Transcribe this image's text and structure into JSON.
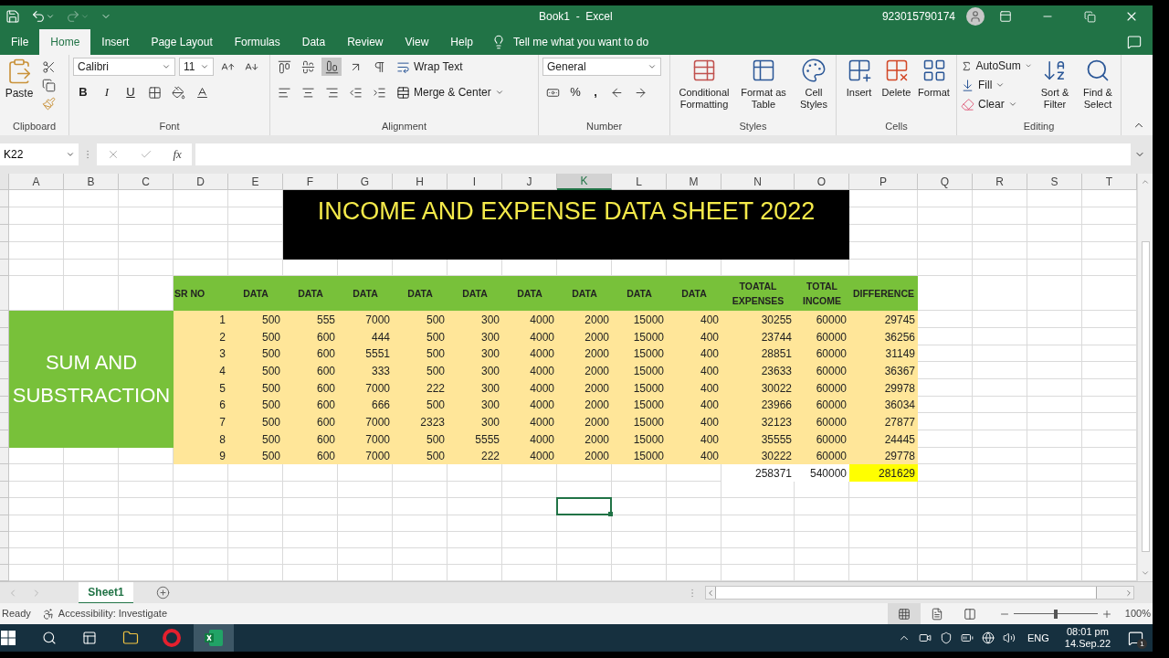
{
  "title_bar": {
    "title": "Book1  -  Excel",
    "account": "923015790174"
  },
  "ribbon_tabs": [
    {
      "label": "File",
      "selected": false
    },
    {
      "label": "Home",
      "selected": true
    },
    {
      "label": "Insert",
      "selected": false
    },
    {
      "label": "Page Layout",
      "selected": false
    },
    {
      "label": "Formulas",
      "selected": false
    },
    {
      "label": "Data",
      "selected": false
    },
    {
      "label": "Review",
      "selected": false
    },
    {
      "label": "View",
      "selected": false
    },
    {
      "label": "Help",
      "selected": false
    }
  ],
  "tell_me": "Tell me what you want to do",
  "ribbon": {
    "clipboard": {
      "paste": "Paste",
      "label": "Clipboard"
    },
    "font": {
      "name": "Calibri",
      "size": "11",
      "bold": "B",
      "italic": "I",
      "underline": "U",
      "label": "Font"
    },
    "alignment": {
      "wrap": "Wrap Text",
      "merge": "Merge & Center",
      "label": "Alignment"
    },
    "number": {
      "format": "General",
      "percent": "%",
      "comma": ",",
      "label": "Number"
    },
    "styles": {
      "buttons": [
        "Conditional Formatting",
        "Format as Table",
        "Cell Styles"
      ],
      "label": "Styles"
    },
    "cells": {
      "buttons": [
        "Insert",
        "Delete",
        "Format"
      ],
      "label": "Cells"
    },
    "editing": {
      "autosum": "AutoSum",
      "fill": "Fill",
      "clear": "Clear",
      "sort": "Sort & Filter",
      "find": "Find & Select",
      "label": "Editing"
    }
  },
  "formula_bar": {
    "name_box": "K22",
    "fx": "fx"
  },
  "columns": [
    {
      "label": "A",
      "selected": false
    },
    {
      "label": "B",
      "selected": false
    },
    {
      "label": "C",
      "selected": false
    },
    {
      "label": "D",
      "selected": false
    },
    {
      "label": "E",
      "selected": false
    },
    {
      "label": "F",
      "selected": false
    },
    {
      "label": "G",
      "selected": false
    },
    {
      "label": "H",
      "selected": false
    },
    {
      "label": "I",
      "selected": false
    },
    {
      "label": "J",
      "selected": false
    },
    {
      "label": "K",
      "selected": true
    },
    {
      "label": "L",
      "selected": false
    },
    {
      "label": "M",
      "selected": false
    },
    {
      "label": "N",
      "selected": false
    },
    {
      "label": "O",
      "selected": false
    },
    {
      "label": "P",
      "selected": false
    },
    {
      "label": "Q",
      "selected": false
    },
    {
      "label": "R",
      "selected": false
    },
    {
      "label": "S",
      "selected": false
    },
    {
      "label": "T",
      "selected": false
    }
  ],
  "sheet": {
    "title": "INCOME AND EXPENSE DATA SHEET 2022",
    "side_label": "SUM AND SUBSTRACTION",
    "headers": [
      "SR NO",
      "DATA",
      "DATA",
      "DATA",
      "DATA",
      "DATA",
      "DATA",
      "DATA",
      "DATA",
      "DATA",
      "TOATAL EXPENSES",
      "TOTAL INCOME",
      "DIFFERENCE"
    ],
    "rows": [
      [
        "1",
        "500",
        "555",
        "7000",
        "500",
        "300",
        "4000",
        "2000",
        "15000",
        "400",
        "30255",
        "60000",
        "29745"
      ],
      [
        "2",
        "500",
        "600",
        "444",
        "500",
        "300",
        "4000",
        "2000",
        "15000",
        "400",
        "23744",
        "60000",
        "36256"
      ],
      [
        "3",
        "500",
        "600",
        "5551",
        "500",
        "300",
        "4000",
        "2000",
        "15000",
        "400",
        "28851",
        "60000",
        "31149"
      ],
      [
        "4",
        "500",
        "600",
        "333",
        "500",
        "300",
        "4000",
        "2000",
        "15000",
        "400",
        "23633",
        "60000",
        "36367"
      ],
      [
        "5",
        "500",
        "600",
        "7000",
        "222",
        "300",
        "4000",
        "2000",
        "15000",
        "400",
        "30022",
        "60000",
        "29978"
      ],
      [
        "6",
        "500",
        "600",
        "666",
        "500",
        "300",
        "4000",
        "2000",
        "15000",
        "400",
        "23966",
        "60000",
        "36034"
      ],
      [
        "7",
        "500",
        "600",
        "7000",
        "2323",
        "300",
        "4000",
        "2000",
        "15000",
        "400",
        "32123",
        "60000",
        "27877"
      ],
      [
        "8",
        "500",
        "600",
        "7000",
        "500",
        "5555",
        "4000",
        "2000",
        "15000",
        "400",
        "35555",
        "60000",
        "24445"
      ],
      [
        "9",
        "500",
        "600",
        "7000",
        "500",
        "222",
        "4000",
        "2000",
        "15000",
        "400",
        "30222",
        "60000",
        "29778"
      ]
    ],
    "totals": [
      "258371",
      "540000",
      "281629"
    ]
  },
  "sheet_tabs": [
    {
      "label": "Sheet1",
      "selected": true
    }
  ],
  "status_bar": {
    "mode": "Ready",
    "accessibility": "Accessibility: Investigate",
    "zoom": "100%",
    "zoom_slider": {
      "level": 0.5
    }
  },
  "taskbar": {
    "language": "ENG",
    "time": "08:01 pm",
    "date": "14.Sep.22",
    "notifications": "1"
  }
}
